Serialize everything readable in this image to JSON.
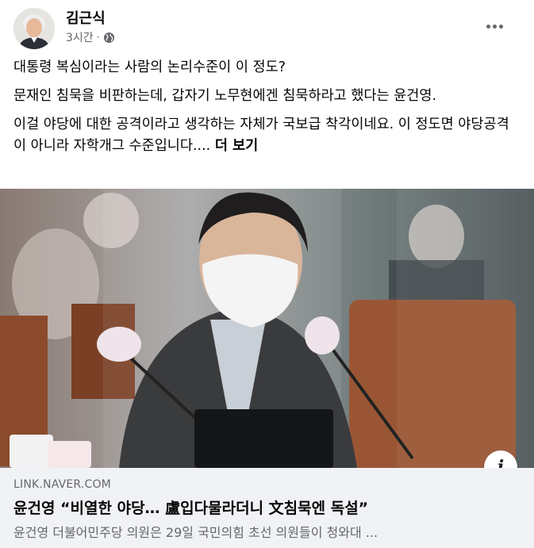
{
  "post": {
    "author": "김근식",
    "time": "3시간",
    "separator": "·",
    "privacy_icon": "globe-icon",
    "more_icon": "more-options-icon"
  },
  "content": {
    "line1": "대통령 복심이라는 사람의 논리수준이 이 정도?",
    "line2": "문재인 침묵을 비판하는데, 갑자기 노무현에겐 침묵하라고 했다는 윤건영.",
    "line3": "이걸 야당에 대한 공격이라고 생각하는 자체가 국보급 착각이네요. 이 정도면 야당공격이 아니라 자학개그 수준입니다....",
    "see_more": "더 보기"
  },
  "image": {
    "info_icon_label": "i"
  },
  "link": {
    "domain": "LINK.NAVER.COM",
    "title": "윤건영 “비열한 야당… 盧입다물라더니 文침묵엔 독설”",
    "description": "윤건영 더불어민주당 의원은 29일 국민의힘 초선 의원들이 청와대 ..."
  },
  "colors": {
    "text_primary": "#050505",
    "text_secondary": "#65676b",
    "link_card_bg": "#f0f2f5"
  }
}
